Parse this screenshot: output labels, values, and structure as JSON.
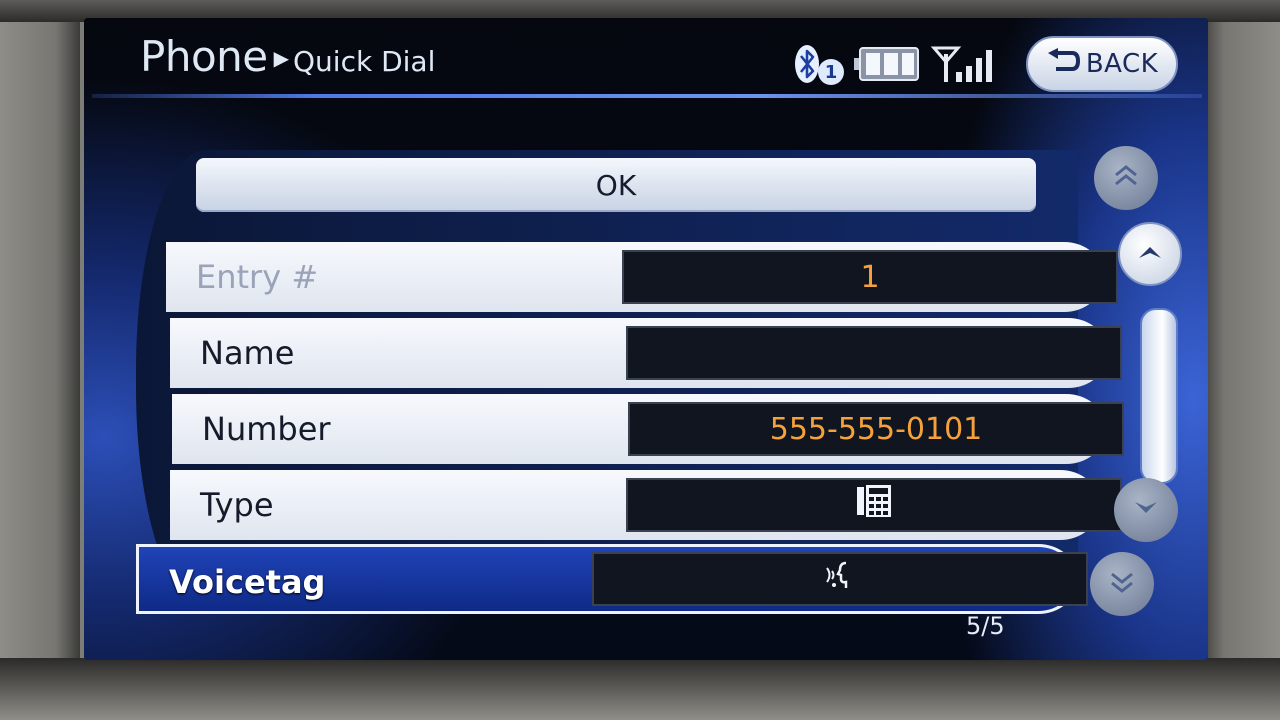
{
  "header": {
    "title": "Phone",
    "separator": "▶",
    "subtitle": "Quick Dial",
    "bluetooth_device": "1",
    "back_label": "BACK"
  },
  "form": {
    "ok_label": "OK",
    "rows": [
      {
        "label": "Entry #",
        "value": "1",
        "state": "disabled"
      },
      {
        "label": "Name",
        "value": ""
      },
      {
        "label": "Number",
        "value": "555-555-0101"
      },
      {
        "label": "Type",
        "value_icon": "phone-keypad-icon"
      },
      {
        "label": "Voicetag",
        "value_icon": "voice-speaking-icon",
        "state": "selected"
      }
    ]
  },
  "page_indicator": "5/5",
  "colors": {
    "accent_value": "#f5a23a",
    "selection_blue": "#1f43b8",
    "header_line": "#4f78e6"
  }
}
